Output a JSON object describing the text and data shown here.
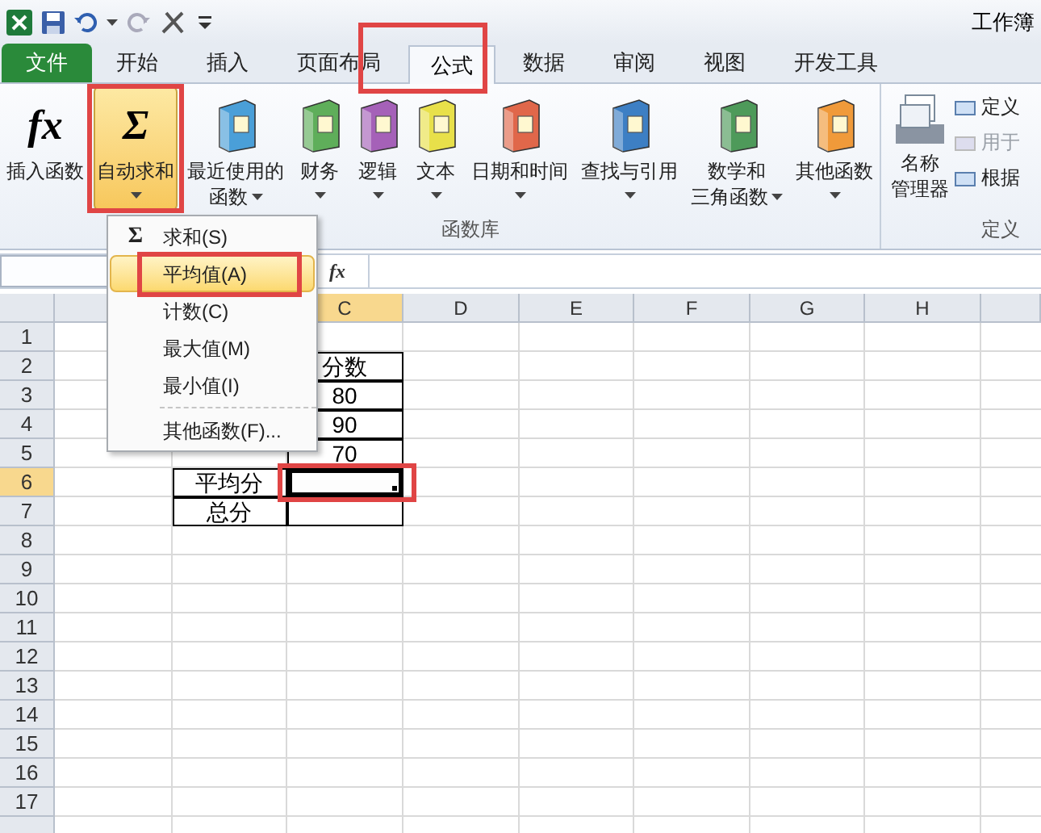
{
  "title_bar": {
    "title": "工作簿"
  },
  "tabs": [
    {
      "label": "文件",
      "kind": "file",
      "selected": false
    },
    {
      "label": "开始",
      "kind": "tab",
      "selected": false
    },
    {
      "label": "插入",
      "kind": "tab",
      "selected": false
    },
    {
      "label": "页面布局",
      "kind": "tab",
      "selected": false
    },
    {
      "label": "公式",
      "kind": "tab",
      "selected": true
    },
    {
      "label": "数据",
      "kind": "tab",
      "selected": false
    },
    {
      "label": "审阅",
      "kind": "tab",
      "selected": false
    },
    {
      "label": "视图",
      "kind": "tab",
      "selected": false
    },
    {
      "label": "开发工具",
      "kind": "tab",
      "selected": false
    }
  ],
  "ribbon": {
    "function_library": {
      "label": "函数库",
      "buttons": [
        {
          "kind": "glyph",
          "glyph": "fx",
          "lines": [
            "插入函数"
          ],
          "pressed": false,
          "dropdown": false
        },
        {
          "kind": "glyph",
          "glyph": "Σ",
          "lines": [
            "自动求和"
          ],
          "pressed": true,
          "dropdown": true
        },
        {
          "kind": "book",
          "color": "#4a9fd8",
          "lines": [
            "最近使用的",
            "函数"
          ],
          "pressed": false,
          "dropdown": true
        },
        {
          "kind": "book",
          "color": "#5fae5a",
          "lines": [
            "财务"
          ],
          "pressed": false,
          "dropdown": true
        },
        {
          "kind": "book",
          "color": "#a561b8",
          "lines": [
            "逻辑"
          ],
          "pressed": false,
          "dropdown": true
        },
        {
          "kind": "book",
          "color": "#e8e04a",
          "lines": [
            "文本"
          ],
          "pressed": false,
          "dropdown": true
        },
        {
          "kind": "book",
          "color": "#e0674a",
          "lines": [
            "日期和时间"
          ],
          "pressed": false,
          "dropdown": true
        },
        {
          "kind": "book",
          "color": "#3d7fc4",
          "lines": [
            "查找与引用"
          ],
          "pressed": false,
          "dropdown": true
        },
        {
          "kind": "book",
          "color": "#4e9a5a",
          "lines": [
            "数学和",
            "三角函数"
          ],
          "pressed": false,
          "dropdown": true
        },
        {
          "kind": "book",
          "color": "#f09a3a",
          "lines": [
            "其他函数"
          ],
          "pressed": false,
          "dropdown": true
        }
      ]
    },
    "defined_names": {
      "label": "定义",
      "manager": {
        "lines": [
          "名称",
          "管理器"
        ]
      },
      "small_buttons": [
        {
          "label": "定义",
          "disabled": false
        },
        {
          "label": "用于",
          "disabled": true
        },
        {
          "label": "根据",
          "disabled": false
        }
      ]
    }
  },
  "formula_bar": {
    "fx": "fx"
  },
  "sheet": {
    "columns": [
      {
        "label": "C",
        "selected": true
      },
      {
        "label": "D",
        "selected": false
      },
      {
        "label": "E",
        "selected": false
      },
      {
        "label": "F",
        "selected": false
      },
      {
        "label": "G",
        "selected": false
      },
      {
        "label": "H",
        "selected": false
      }
    ],
    "rows": [
      {
        "label": "1",
        "selected": false
      },
      {
        "label": "2",
        "selected": false,
        "column_c": {
          "text": "分数",
          "selected": false
        }
      },
      {
        "label": "3",
        "selected": false,
        "column_c": {
          "text": "80",
          "selected": false
        }
      },
      {
        "label": "4",
        "selected": false,
        "column_c": {
          "text": "90",
          "selected": false
        }
      },
      {
        "label": "5",
        "selected": false,
        "column_c": {
          "text": "70",
          "selected": false
        }
      },
      {
        "label": "6",
        "selected": true,
        "column_b": {
          "text": "平均分",
          "selected": false
        },
        "column_c": {
          "selected": true
        }
      },
      {
        "label": "7",
        "selected": false,
        "column_b": {
          "text": "总分",
          "selected": false
        },
        "column_c": {
          "selected": false
        }
      },
      {
        "label": "8",
        "selected": false
      },
      {
        "label": "9",
        "selected": false
      },
      {
        "label": "10",
        "selected": false
      },
      {
        "label": "11",
        "selected": false
      },
      {
        "label": "12",
        "selected": false
      },
      {
        "label": "13",
        "selected": false
      },
      {
        "label": "14",
        "selected": false
      },
      {
        "label": "15",
        "selected": false
      },
      {
        "label": "16",
        "selected": false
      },
      {
        "label": "17",
        "selected": false
      }
    ]
  },
  "autosum_menu": {
    "items": [
      {
        "kind": "item",
        "glyph": "Σ",
        "label": "求和(S)",
        "selected": false
      },
      {
        "kind": "item",
        "label": "平均值(A)",
        "selected": true
      },
      {
        "kind": "item",
        "label": "计数(C)",
        "selected": false
      },
      {
        "kind": "item",
        "label": "最大值(M)",
        "selected": false
      },
      {
        "kind": "item",
        "label": "最小值(I)",
        "selected": false
      },
      {
        "kind": "separator"
      },
      {
        "kind": "item",
        "label": "其他函数(F)...",
        "selected": false
      }
    ]
  }
}
